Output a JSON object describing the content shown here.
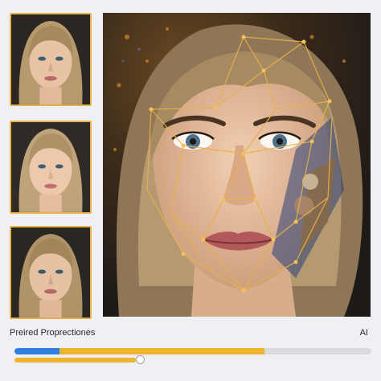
{
  "caption": {
    "left_label": "Preired Proprectiones",
    "right_label": "AI"
  },
  "thumbnails": [
    {
      "icon": "portrait-thumbnail"
    },
    {
      "icon": "portrait-thumbnail"
    },
    {
      "icon": "portrait-thumbnail"
    }
  ],
  "progress": {
    "primary_segments": [
      {
        "color": "#2f7fe0",
        "fraction": 0.126
      },
      {
        "color": "#f0b330",
        "fraction": 0.574
      }
    ],
    "slider_value": 0.34
  },
  "colors": {
    "accent_border": "#e8b24a",
    "blue": "#2f7fe0",
    "yellow": "#f0b330"
  }
}
